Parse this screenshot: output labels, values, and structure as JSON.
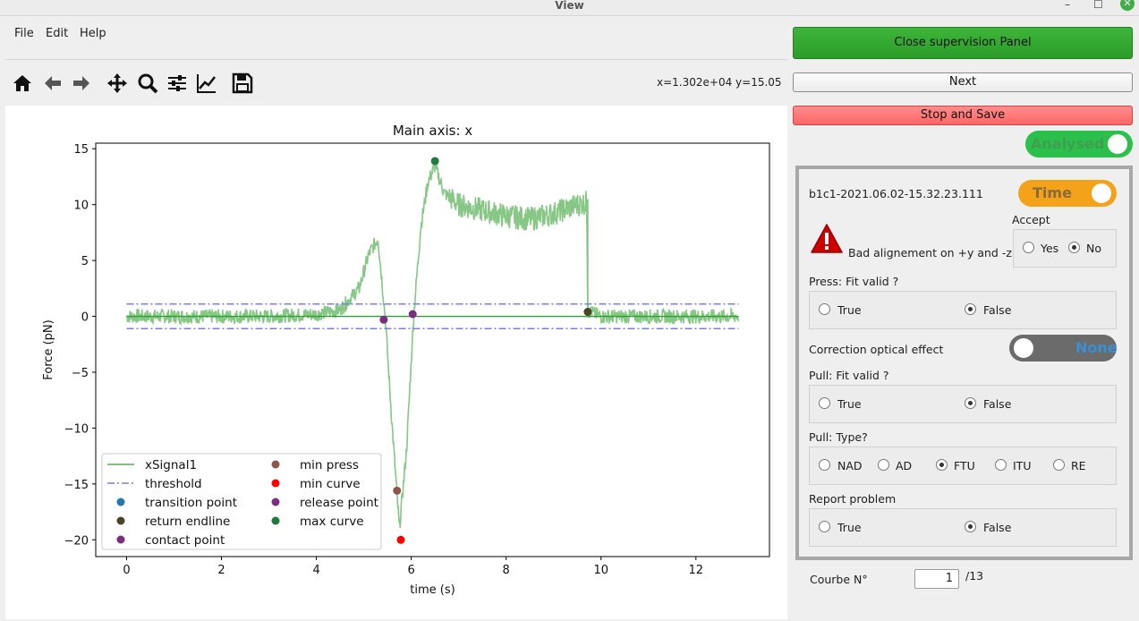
{
  "window": {
    "title": "View",
    "minimize": "–",
    "maximize": "☐",
    "close": "✕"
  },
  "menu": [
    "File",
    "Edit",
    "Help"
  ],
  "toolbar": {
    "icons": [
      "home-icon",
      "back-arrow-icon",
      "forward-arrow-icon",
      "pan-icon",
      "zoom-icon",
      "configure-subplots-icon",
      "edit-axis-icon",
      "save-icon"
    ],
    "coord_readout": "x=1.302e+04 y=15.05"
  },
  "chart_data": {
    "type": "line",
    "title": "Main axis: x",
    "xlabel": "time (s)",
    "ylabel": "Force (pN)",
    "xlim": [
      -0.65,
      13.55
    ],
    "ylim": [
      -21.5,
      15.5
    ],
    "xticks": [
      "0",
      "2",
      "4",
      "6",
      "8",
      "10",
      "12"
    ],
    "xtick_values": [
      0,
      2,
      4,
      6,
      8,
      10,
      12
    ],
    "yticks": [
      "15",
      "10",
      "5",
      "0",
      "−5",
      "−10",
      "−15",
      "−20"
    ],
    "ytick_values": [
      15,
      10,
      5,
      0,
      -5,
      -10,
      -15,
      -20
    ],
    "series": [
      {
        "name": "xSignal1",
        "color": "#7fc47f",
        "x": [
          0,
          1,
          2,
          3,
          4,
          4.5,
          4.9,
          5.1,
          5.3,
          5.45,
          5.6,
          5.75,
          5.9,
          6.05,
          6.2,
          6.35,
          6.5,
          6.7,
          7.0,
          7.5,
          8.0,
          8.5,
          9.0,
          9.5,
          9.7,
          9.72,
          10,
          11,
          12,
          12.9
        ],
        "y": [
          0,
          0,
          0,
          0,
          0.2,
          0.6,
          2.5,
          5.5,
          7,
          0,
          -10,
          -19,
          -12,
          0,
          8,
          12,
          13.5,
          11,
          10,
          9.5,
          9,
          8.7,
          9.2,
          10,
          10.2,
          0.5,
          0,
          0,
          0,
          0
        ]
      },
      {
        "name": "threshold",
        "color": "#7b7bf0",
        "dash": "dashdot",
        "x": [
          0,
          12.9
        ],
        "upper": 1.1,
        "lower": -1.1
      }
    ],
    "baseline": {
      "color": "#2ca02c",
      "x": [
        0,
        12.9
      ],
      "y": 0
    },
    "points": [
      {
        "name": "min press",
        "x": 5.7,
        "y": -15.6,
        "color": "#8c564b"
      },
      {
        "name": "min curve",
        "x": 5.78,
        "y": -20,
        "color": "#ff0000"
      },
      {
        "name": "release point",
        "x": 5.42,
        "y": -0.3,
        "color": "#7b2d82"
      },
      {
        "name": "contact point",
        "x": 6.03,
        "y": 0.2,
        "color": "#7b2d82"
      },
      {
        "name": "max curve",
        "x": 6.5,
        "y": 13.9,
        "color": "#1f7a3b"
      },
      {
        "name": "return endline",
        "x": 9.72,
        "y": 0.4,
        "color": "#4a4425"
      }
    ],
    "legend": {
      "placement": "lower-left",
      "left_column": [
        {
          "label": "xSignal1",
          "kind": "line",
          "color": "#7fc47f"
        },
        {
          "label": "threshold",
          "kind": "dashdot",
          "color": "#7b7bf0"
        },
        {
          "label": "transition point",
          "kind": "dot",
          "color": "#1f77b4"
        },
        {
          "label": "return endline",
          "kind": "dot",
          "color": "#4a4425"
        },
        {
          "label": "contact point",
          "kind": "dot",
          "color": "#7b2d82"
        }
      ],
      "right_column": [
        {
          "label": "min press",
          "kind": "dot",
          "color": "#8c564b"
        },
        {
          "label": "min curve",
          "kind": "dot",
          "color": "#ff0000"
        },
        {
          "label": "release point",
          "kind": "dot",
          "color": "#7b2d82"
        },
        {
          "label": "max curve",
          "kind": "dot",
          "color": "#1f7a3b"
        }
      ]
    },
    "grid": false
  },
  "panel": {
    "close_supervision": "Close supervision Panel",
    "next": "Next",
    "stop_save": "Stop and Save",
    "analysed_toggle": "Analysed",
    "curve_name": "b1c1-2021.06.02-15.32.23.111",
    "time_toggle": "Time",
    "warning_text": "Bad alignement on +y and -z",
    "accept": {
      "label": "Accept",
      "yes": "Yes",
      "no": "No",
      "selected": "No"
    },
    "press_fit": {
      "label": "Press: Fit valid ?",
      "true": "True",
      "false": "False",
      "selected": "False"
    },
    "correction": {
      "label": "Correction optical effect",
      "toggle": "None"
    },
    "pull_fit": {
      "label": "Pull: Fit valid ?",
      "true": "True",
      "false": "False",
      "selected": "False"
    },
    "pull_type": {
      "label": "Pull: Type?",
      "options": [
        "NAD",
        "AD",
        "FTU",
        "ITU",
        "RE"
      ],
      "selected": "FTU"
    },
    "report": {
      "label": "Report problem",
      "true": "True",
      "false": "False",
      "selected": "False"
    },
    "curve_no": {
      "label": "Courbe N°",
      "value": "1",
      "total": "/13"
    }
  },
  "colors": {
    "green_button": "#2ea82b",
    "red_button": "#ff6b6b",
    "analysed_toggle": "#2bc04b",
    "time_toggle": "#f3a21a",
    "none_toggle": "#6b6b6b",
    "none_text": "#3b8fd6"
  }
}
